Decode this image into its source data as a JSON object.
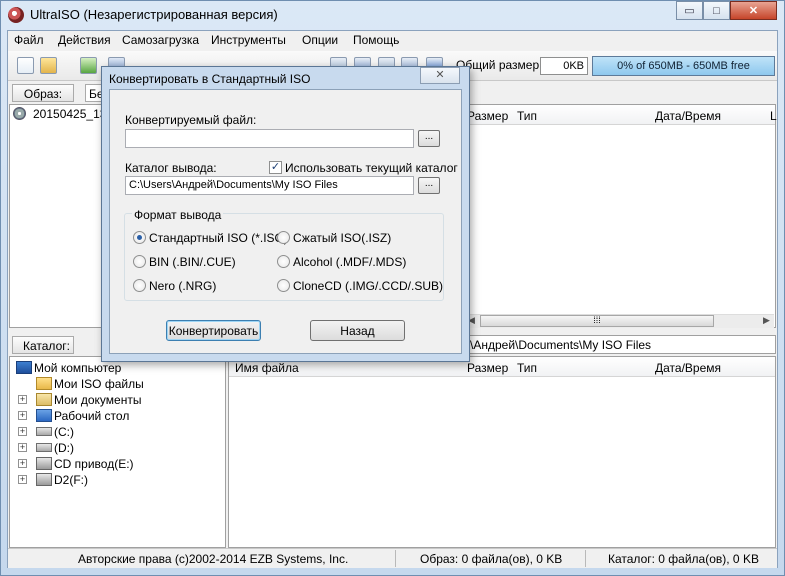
{
  "window": {
    "title": "UltraISO (Незарегистрированная версия)",
    "minimize": "▭",
    "maximize": "□",
    "close": "✕"
  },
  "menu": [
    "Файл",
    "Действия",
    "Самозагрузка",
    "Инструменты",
    "Опции",
    "Помощь"
  ],
  "toolbar": {
    "size_label": "Общий размер:",
    "size_value": "0KB",
    "size_bar": "0% of 650MB - 650MB free"
  },
  "image_row": {
    "label": "Образ:",
    "value": "Бе"
  },
  "iso_item": "20150425_13",
  "columns": {
    "size": "Размер",
    "type": "Тип",
    "date": "Дата/Время",
    "extra": "L",
    "name": "Имя файла"
  },
  "catalog": {
    "label": "Каталог:",
    "path": "\\Андрей\\Documents\\My ISO Files"
  },
  "tree": [
    {
      "label": "Мой компьютер",
      "icon": "computer-icon",
      "expander": ""
    },
    {
      "label": "Мои ISO файлы",
      "icon": "folder-icon",
      "expander": ""
    },
    {
      "label": "Мои документы",
      "icon": "documents-icon",
      "expander": "+"
    },
    {
      "label": "Рабочий стол",
      "icon": "desktop-icon",
      "expander": "+"
    },
    {
      "label": "(C:)",
      "icon": "drive-icon",
      "expander": "+"
    },
    {
      "label": "(D:)",
      "icon": "drive-icon",
      "expander": "+"
    },
    {
      "label": "CD привод(E:)",
      "icon": "cd-drive-icon",
      "expander": "+"
    },
    {
      "label": "D2(F:)",
      "icon": "cd-drive-icon",
      "expander": "+"
    }
  ],
  "status": {
    "copyright": "Авторские права (c)2002-2014 EZB Systems, Inc.",
    "image": "Образ: 0 файла(ов), 0 KB",
    "catalog": "Каталог: 0 файла(ов), 0 KB"
  },
  "dialog": {
    "title": "Конвертировать в Стандартный ISO",
    "source_label": "Конвертируемый файл:",
    "source_value": "",
    "browse": "...",
    "output_label": "Каталог вывода:",
    "use_current_label": "Использовать текущий каталог",
    "use_current_checked": true,
    "output_value": "C:\\Users\\Андрей\\Documents\\My ISO Files",
    "format_legend": "Формат вывода",
    "formats": [
      {
        "label": "Стандартный ISO (*.ISO)",
        "selected": true
      },
      {
        "label": "Сжатый ISO(.ISZ)",
        "selected": false
      },
      {
        "label": "BIN (.BIN/.CUE)",
        "selected": false
      },
      {
        "label": "Alcohol (.MDF/.MDS)",
        "selected": false
      },
      {
        "label": "Nero (.NRG)",
        "selected": false
      },
      {
        "label": "CloneCD (.IMG/.CCD/.SUB)",
        "selected": false
      }
    ],
    "convert_button": "Конвертировать",
    "back_button": "Назад"
  },
  "colors": {
    "accent": "#3c7fb1",
    "titlebar": "#c5d8ed",
    "close": "#c6452a"
  }
}
